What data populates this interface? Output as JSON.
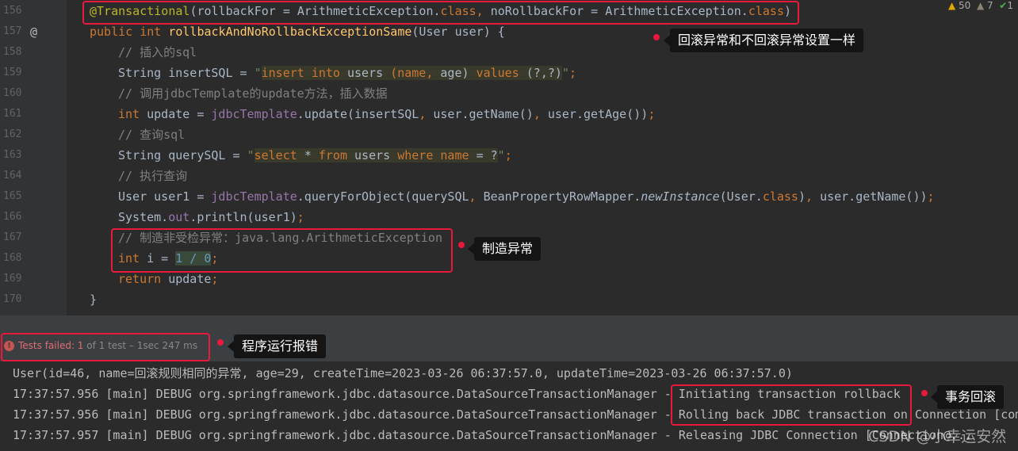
{
  "inspections": {
    "warnings": "50",
    "weak_warnings": "7",
    "ok": "1"
  },
  "code_lines": [
    {
      "n": "156",
      "indent": 0,
      "t": [
        [
          "@Transactional",
          "an"
        ],
        [
          "(rollbackFor = ArithmeticException.",
          ""
        ],
        [
          "class",
          "kw"
        ],
        [
          ", ",
          "kw"
        ],
        [
          "noRollbackFor = ArithmeticException.",
          ""
        ],
        [
          "class",
          "kw"
        ],
        [
          ")",
          ""
        ]
      ]
    },
    {
      "n": "157",
      "indent": 0,
      "t": [
        [
          "public int ",
          "kw"
        ],
        [
          "rollbackAndNoRollbackExceptionSame",
          "fn"
        ],
        [
          "(User user) {",
          ""
        ]
      ]
    },
    {
      "n": "158",
      "indent": 1,
      "t": [
        [
          "// 插入的sql",
          "cm"
        ]
      ]
    },
    {
      "n": "159",
      "indent": 1,
      "t": [
        [
          "String insertSQL = ",
          ""
        ],
        [
          "\"",
          "st"
        ],
        [
          "insert into ",
          "sqk"
        ],
        [
          "users ",
          "sq"
        ],
        [
          "(",
          "sqk"
        ],
        [
          "name, ",
          "sqk"
        ],
        [
          "age) ",
          "sq"
        ],
        [
          "values ",
          "sqk"
        ],
        [
          "(?,?)",
          "sq"
        ],
        [
          "\"",
          "st"
        ],
        [
          ";",
          "kw"
        ]
      ]
    },
    {
      "n": "160",
      "indent": 1,
      "t": [
        [
          "// 调用jdbcTemplate的update方法，插入数据",
          "cm"
        ]
      ]
    },
    {
      "n": "161",
      "indent": 1,
      "t": [
        [
          "int ",
          "kw"
        ],
        [
          "update = ",
          ""
        ],
        [
          "jdbcTemplate",
          "fd"
        ],
        [
          ".update(insertSQL",
          ""
        ],
        [
          ", ",
          "kw"
        ],
        [
          "user.getName()",
          ""
        ],
        [
          ", ",
          "kw"
        ],
        [
          "user.getAge())",
          ""
        ],
        [
          ";",
          "kw"
        ]
      ]
    },
    {
      "n": "162",
      "indent": 1,
      "t": [
        [
          "// 查询sql",
          "cm"
        ]
      ]
    },
    {
      "n": "163",
      "indent": 1,
      "t": [
        [
          "String querySQL = ",
          ""
        ],
        [
          "\"",
          "st"
        ],
        [
          "select ",
          "sqk"
        ],
        [
          "* ",
          "sq"
        ],
        [
          "from ",
          "sqk"
        ],
        [
          "users ",
          "sq"
        ],
        [
          "where ",
          "sqk"
        ],
        [
          "name ",
          "sqk"
        ],
        [
          "= ?",
          "sq"
        ],
        [
          "\"",
          "st"
        ],
        [
          ";",
          "kw"
        ]
      ]
    },
    {
      "n": "164",
      "indent": 1,
      "t": [
        [
          "// 执行查询",
          "cm"
        ]
      ]
    },
    {
      "n": "165",
      "indent": 1,
      "t": [
        [
          "User user1 = ",
          ""
        ],
        [
          "jdbcTemplate",
          "fd"
        ],
        [
          ".queryForObject(querySQL",
          ""
        ],
        [
          ", ",
          "kw"
        ],
        [
          "BeanPropertyRowMapper.",
          ""
        ],
        [
          "newInstance",
          "it"
        ],
        [
          "(User.",
          ""
        ],
        [
          "class",
          "kw"
        ],
        [
          ")",
          ""
        ],
        [
          ", ",
          "kw"
        ],
        [
          "user.getName())",
          ""
        ],
        [
          ";",
          "kw"
        ]
      ]
    },
    {
      "n": "166",
      "indent": 1,
      "t": [
        [
          "System.",
          ""
        ],
        [
          "out",
          "fd"
        ],
        [
          ".println(user1)",
          ""
        ],
        [
          ";",
          "kw"
        ]
      ]
    },
    {
      "n": "167",
      "indent": 1,
      "t": [
        [
          "// 制造非受检异常：java.lang.ArithmeticException",
          "cm"
        ]
      ]
    },
    {
      "n": "168",
      "indent": 1,
      "t": [
        [
          "int ",
          "kw"
        ],
        [
          "i = ",
          ""
        ],
        [
          "1 / 0",
          "num"
        ],
        [
          ";",
          "kw"
        ]
      ]
    },
    {
      "n": "169",
      "indent": 1,
      "t": [
        [
          "return ",
          "kw"
        ],
        [
          "update",
          ""
        ],
        [
          ";",
          "kw"
        ]
      ]
    },
    {
      "n": "170",
      "indent": 0,
      "t": [
        [
          "}",
          ""
        ]
      ]
    }
  ],
  "tests": {
    "failed_label": "Tests failed: 1",
    "rest": " of 1 test – 1sec 247 ms"
  },
  "console": [
    "User(id=46, name=回滚规则相同的异常, age=29, createTime=2023-03-26 06:37:57.0, updateTime=2023-03-26 06:37:57.0)",
    "17:37:57.956 [main] DEBUG org.springframework.jdbc.datasource.DataSourceTransactionManager - Initiating transaction rollback",
    "17:37:57.956 [main] DEBUG org.springframework.jdbc.datasource.DataSourceTransactionManager - Rolling back JDBC transaction on Connection [com",
    "17:37:57.957 [main] DEBUG org.springframework.jdbc.datasource.DataSourceTransactionManager - Releasing JDBC Connection [Connection@..."
  ],
  "annotations": {
    "same": "回滚异常和不回滚异常设置一样",
    "exception": "制造异常",
    "error": "程序运行报错",
    "rollback": "事务回滚"
  },
  "watermark": "CSDN @小幸运安然",
  "colors": {
    "highlight": "#e8193c",
    "error": "#e06c75"
  }
}
